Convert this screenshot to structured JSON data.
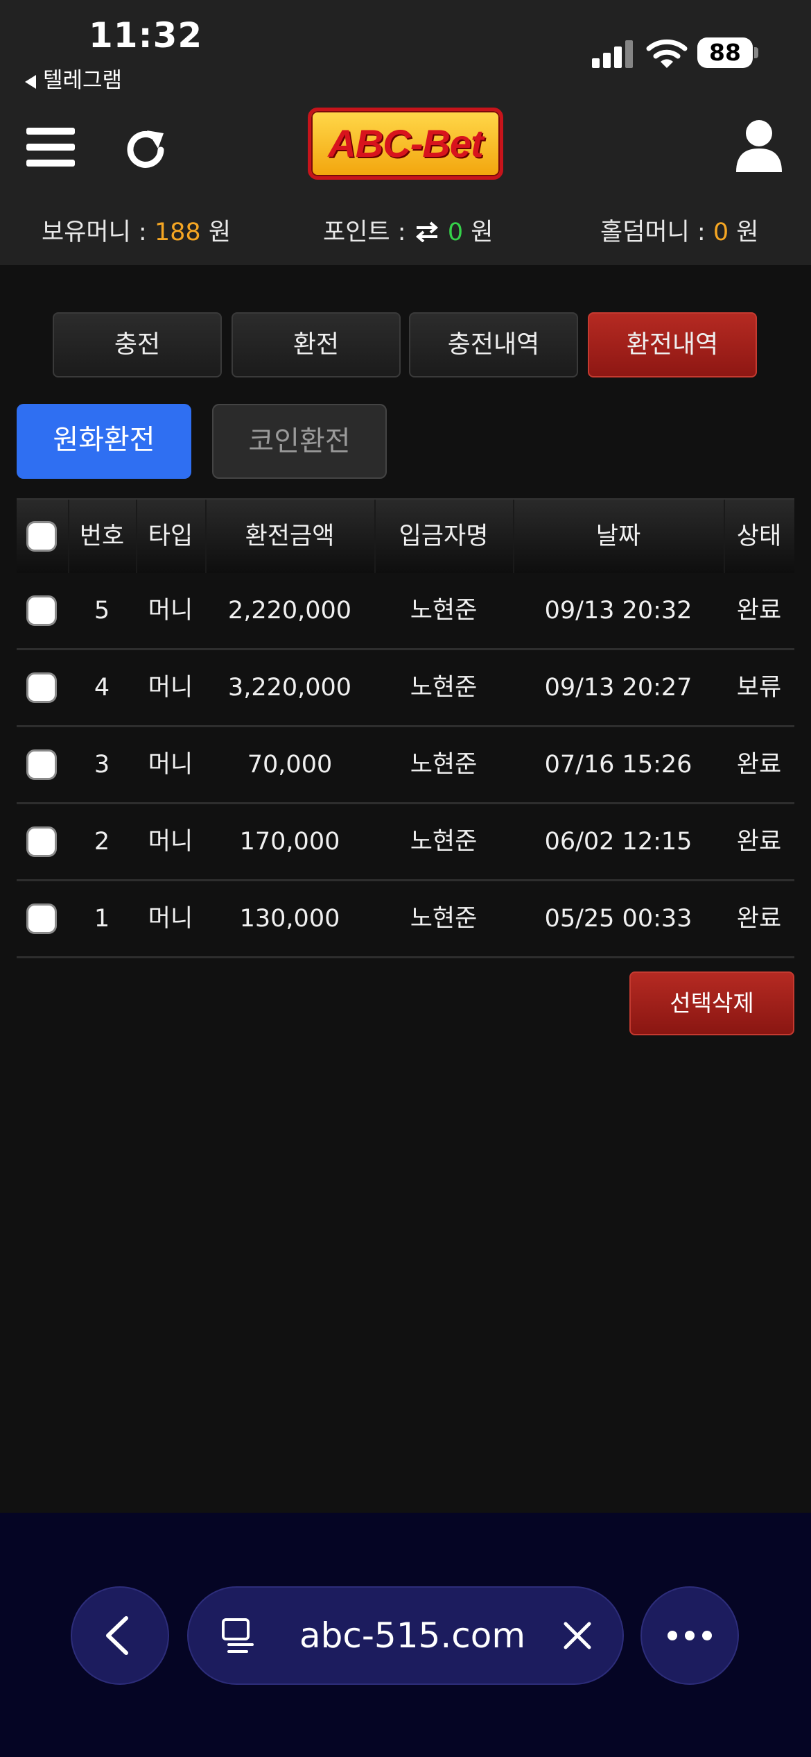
{
  "status": {
    "time": "11:32",
    "back_app": "텔레그램",
    "battery": "88"
  },
  "header": {
    "logo_text": "ABC-Bet"
  },
  "balances": {
    "money_label": "보유머니 :",
    "money_value": "188",
    "money_unit": "원",
    "point_label": "포인트 :",
    "point_value": "0",
    "point_unit": "원",
    "holdem_label": "홀덤머니 :",
    "holdem_value": "0",
    "holdem_unit": "원"
  },
  "tabs": [
    {
      "label": "충전"
    },
    {
      "label": "환전"
    },
    {
      "label": "충전내역"
    },
    {
      "label": "환전내역"
    }
  ],
  "subtabs": [
    {
      "label": "원화환전"
    },
    {
      "label": "코인환전"
    }
  ],
  "table": {
    "headers": [
      "번호",
      "타입",
      "환전금액",
      "입금자명",
      "날짜",
      "상태"
    ],
    "rows": [
      {
        "no": "5",
        "type": "머니",
        "amount": "2,220,000",
        "name": "노현준",
        "date": "09/13 20:32",
        "status": "완료"
      },
      {
        "no": "4",
        "type": "머니",
        "amount": "3,220,000",
        "name": "노현준",
        "date": "09/13 20:27",
        "status": "보류"
      },
      {
        "no": "3",
        "type": "머니",
        "amount": "70,000",
        "name": "노현준",
        "date": "07/16 15:26",
        "status": "완료"
      },
      {
        "no": "2",
        "type": "머니",
        "amount": "170,000",
        "name": "노현준",
        "date": "06/02 12:15",
        "status": "완료"
      },
      {
        "no": "1",
        "type": "머니",
        "amount": "130,000",
        "name": "노현준",
        "date": "05/25 00:33",
        "status": "완료"
      }
    ]
  },
  "actions": {
    "delete_label": "선택삭제"
  },
  "browser": {
    "url": "abc-515.com"
  },
  "colors": {
    "accent_red": "#b52a22",
    "accent_blue": "#2f6ff2",
    "money_orange": "#f5a623",
    "point_green": "#35d14a"
  }
}
